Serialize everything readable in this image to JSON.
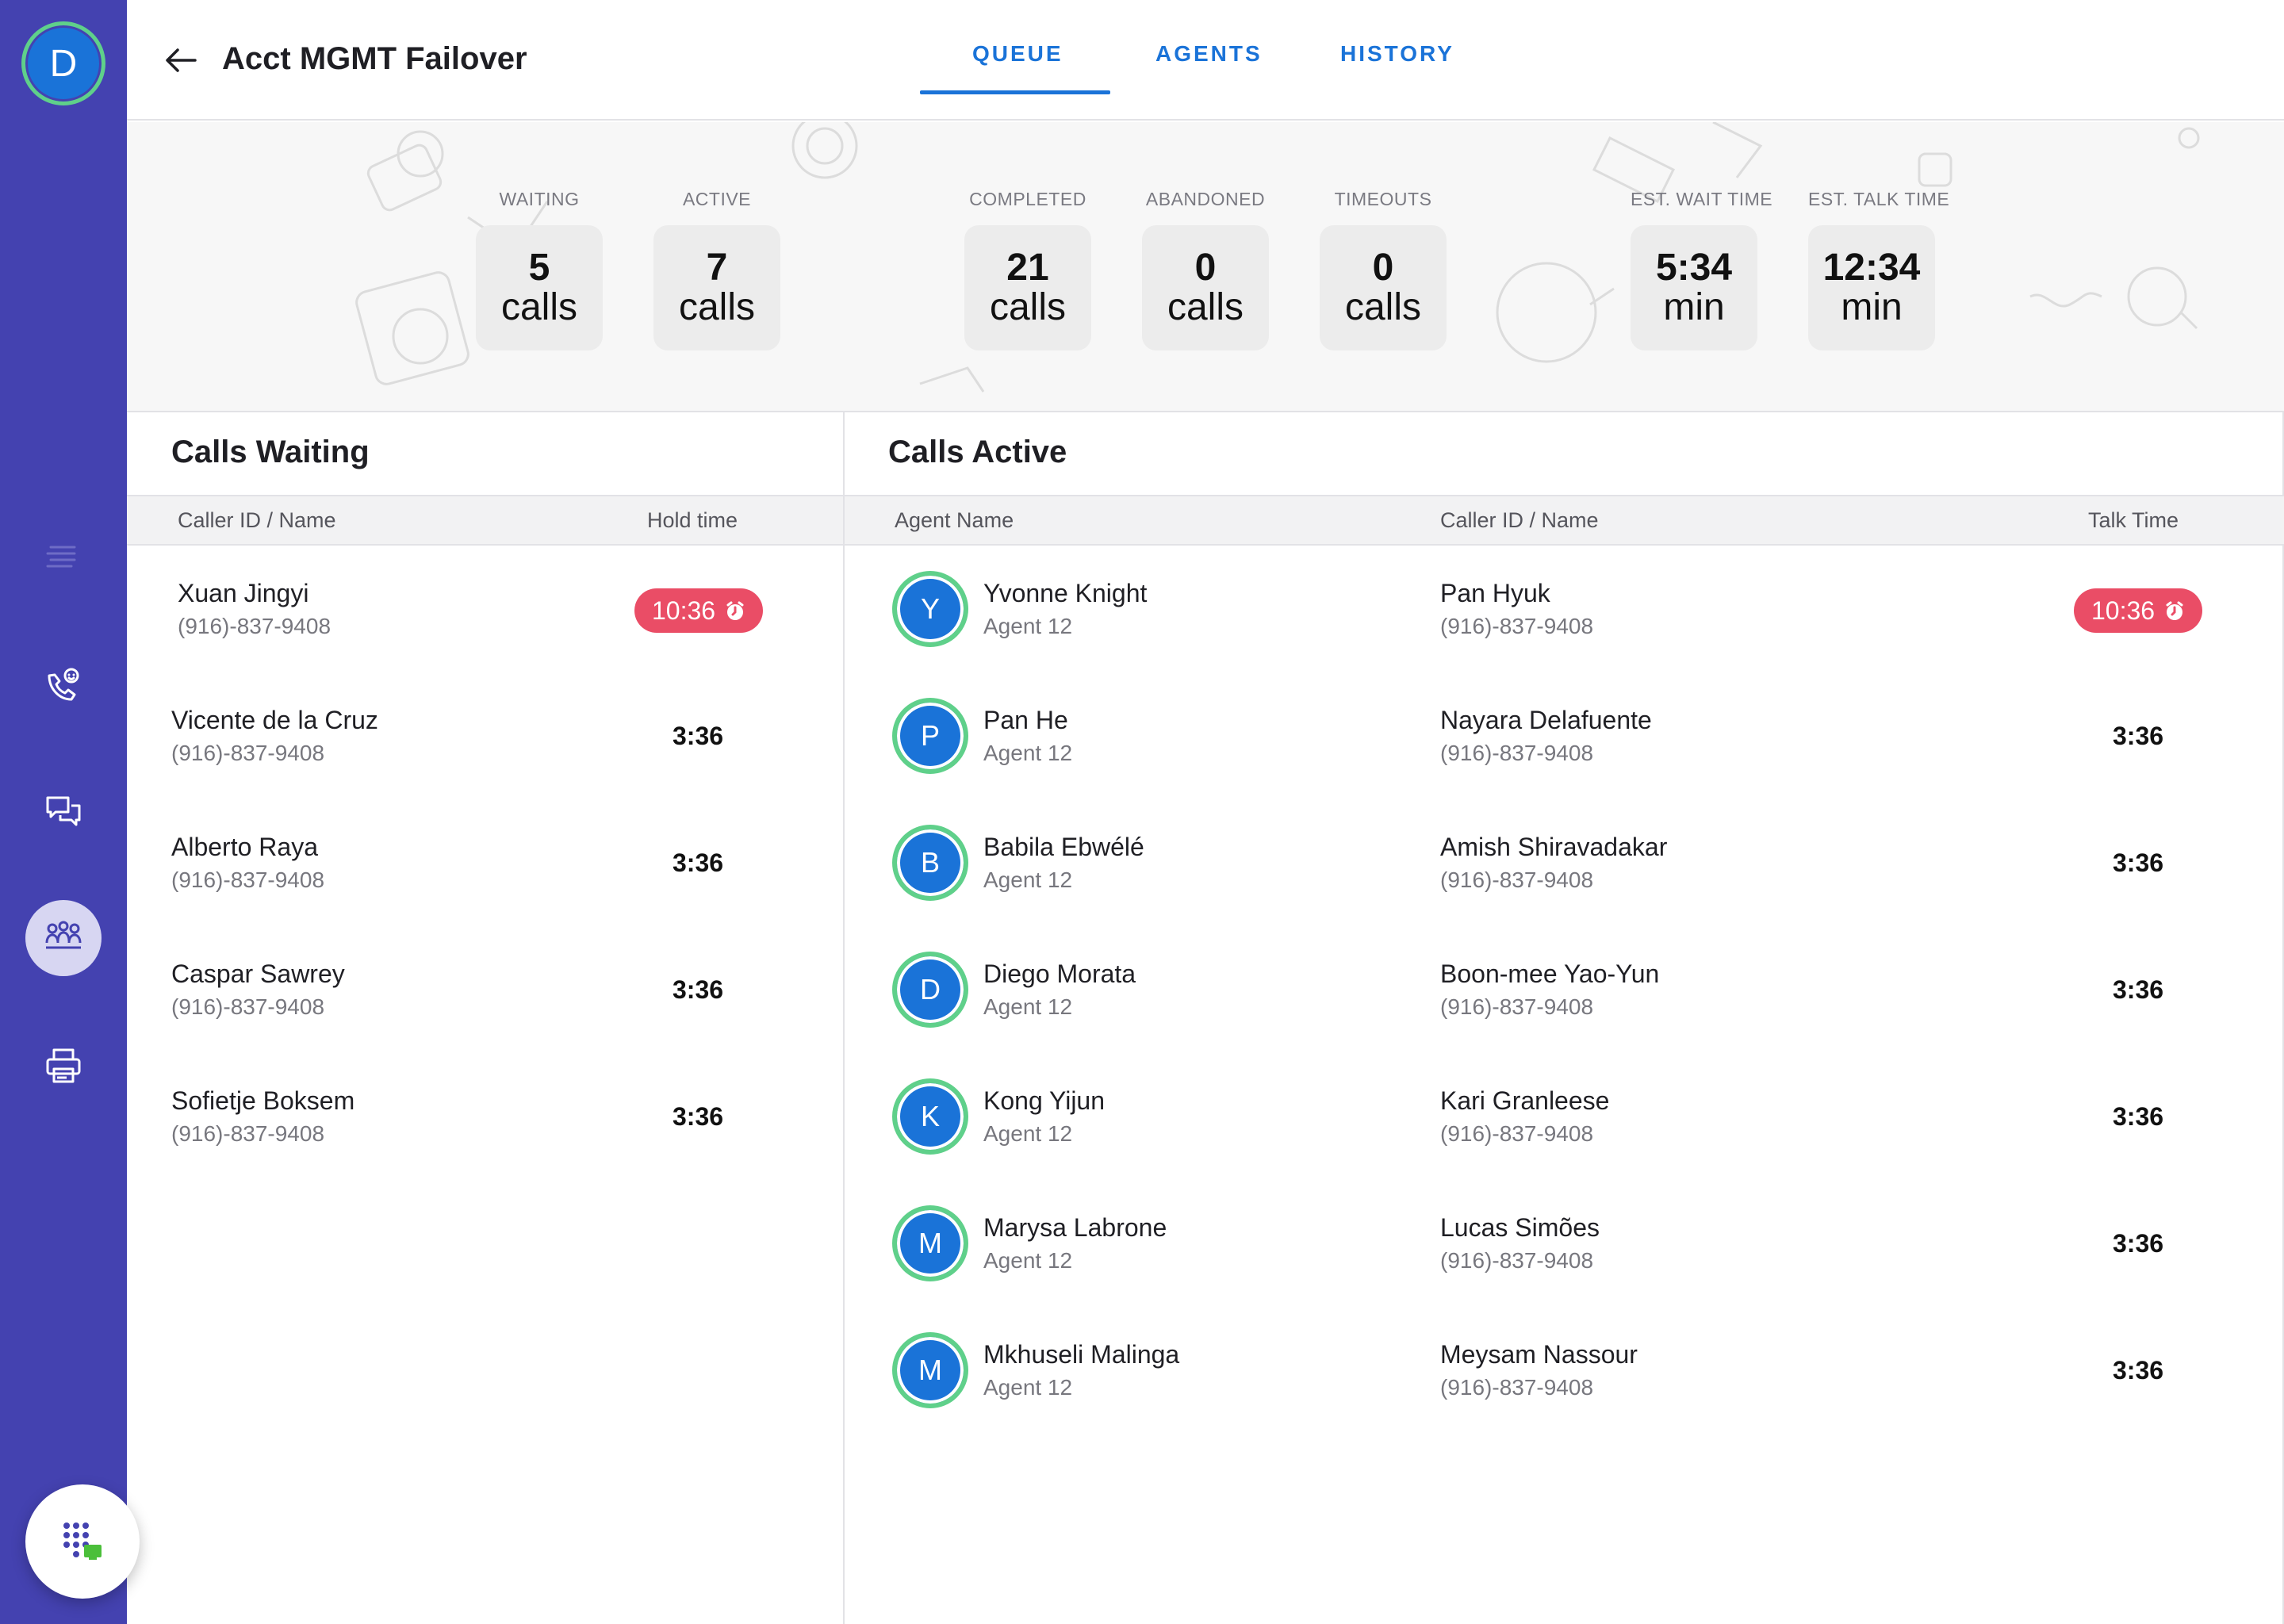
{
  "sidebar": {
    "avatar_initial": "D",
    "nav_icons": [
      "list-icon",
      "phone-support-icon",
      "chat-icon",
      "queue-group-icon",
      "printer-icon"
    ],
    "active_item": "queue-group-icon"
  },
  "header": {
    "title": "Acct MGMT Failover",
    "tabs": [
      {
        "label": "QUEUE",
        "active": true
      },
      {
        "label": "AGENTS",
        "active": false
      },
      {
        "label": "HISTORY",
        "active": false
      }
    ]
  },
  "stats": [
    {
      "label": "WAITING",
      "value": "5",
      "unit": "calls"
    },
    {
      "label": "ACTIVE",
      "value": "7",
      "unit": "calls"
    },
    {
      "label": "COMPLETED",
      "value": "21",
      "unit": "calls"
    },
    {
      "label": "ABANDONED",
      "value": "0",
      "unit": "calls"
    },
    {
      "label": "TIMEOUTS",
      "value": "0",
      "unit": "calls"
    },
    {
      "label": "EST. WAIT TIME",
      "value": "5:34",
      "unit": "min"
    },
    {
      "label": "EST. TALK TIME",
      "value": "12:34",
      "unit": "min"
    }
  ],
  "waiting": {
    "title": "Calls Waiting",
    "columns": [
      "Caller ID / Name",
      "Hold time"
    ],
    "rows": [
      {
        "name": "Xuan Jingyi",
        "phone": "(916)-837-9408",
        "time": "10:36",
        "alert": true
      },
      {
        "name": "Vicente de la Cruz",
        "phone": "(916)-837-9408",
        "time": "3:36",
        "alert": false
      },
      {
        "name": "Alberto Raya",
        "phone": "(916)-837-9408",
        "time": "3:36",
        "alert": false
      },
      {
        "name": "Caspar Sawrey",
        "phone": "(916)-837-9408",
        "time": "3:36",
        "alert": false
      },
      {
        "name": "Sofietje Boksem",
        "phone": "(916)-837-9408",
        "time": "3:36",
        "alert": false
      }
    ]
  },
  "active": {
    "title": "Calls Active",
    "columns": [
      "Agent Name",
      "Caller ID / Name",
      "Talk Time"
    ],
    "rows": [
      {
        "initial": "Y",
        "agent": "Yvonne Knight",
        "agent_sub": "Agent 12",
        "caller": "Pan Hyuk",
        "phone": "(916)-837-9408",
        "time": "10:36",
        "alert": true
      },
      {
        "initial": "P",
        "agent": "Pan He",
        "agent_sub": "Agent 12",
        "caller": "Nayara Delafuente",
        "phone": "(916)-837-9408",
        "time": "3:36",
        "alert": false
      },
      {
        "initial": "B",
        "agent": "Babila Ebwélé",
        "agent_sub": "Agent 12",
        "caller": "Amish Shiravadakar",
        "phone": "(916)-837-9408",
        "time": "3:36",
        "alert": false
      },
      {
        "initial": "D",
        "agent": "Diego Morata",
        "agent_sub": "Agent 12",
        "caller": "Boon-mee Yao-Yun",
        "phone": "(916)-837-9408",
        "time": "3:36",
        "alert": false
      },
      {
        "initial": "K",
        "agent": "Kong Yijun",
        "agent_sub": "Agent 12",
        "caller": "Kari Granleese",
        "phone": "(916)-837-9408",
        "time": "3:36",
        "alert": false
      },
      {
        "initial": "M",
        "agent": "Marysa Labrone",
        "agent_sub": "Agent 12",
        "caller": "Lucas Simões",
        "phone": "(916)-837-9408",
        "time": "3:36",
        "alert": false
      },
      {
        "initial": "M",
        "agent": "Mkhuseli Malinga",
        "agent_sub": "Agent 12",
        "caller": "Meysam Nassour",
        "phone": "(916)-837-9408",
        "time": "3:36",
        "alert": false
      }
    ]
  },
  "colors": {
    "sidebar": "#4442b0",
    "accent": "#1a73d8",
    "alert": "#ea4d66",
    "ring": "#5fd08a"
  }
}
